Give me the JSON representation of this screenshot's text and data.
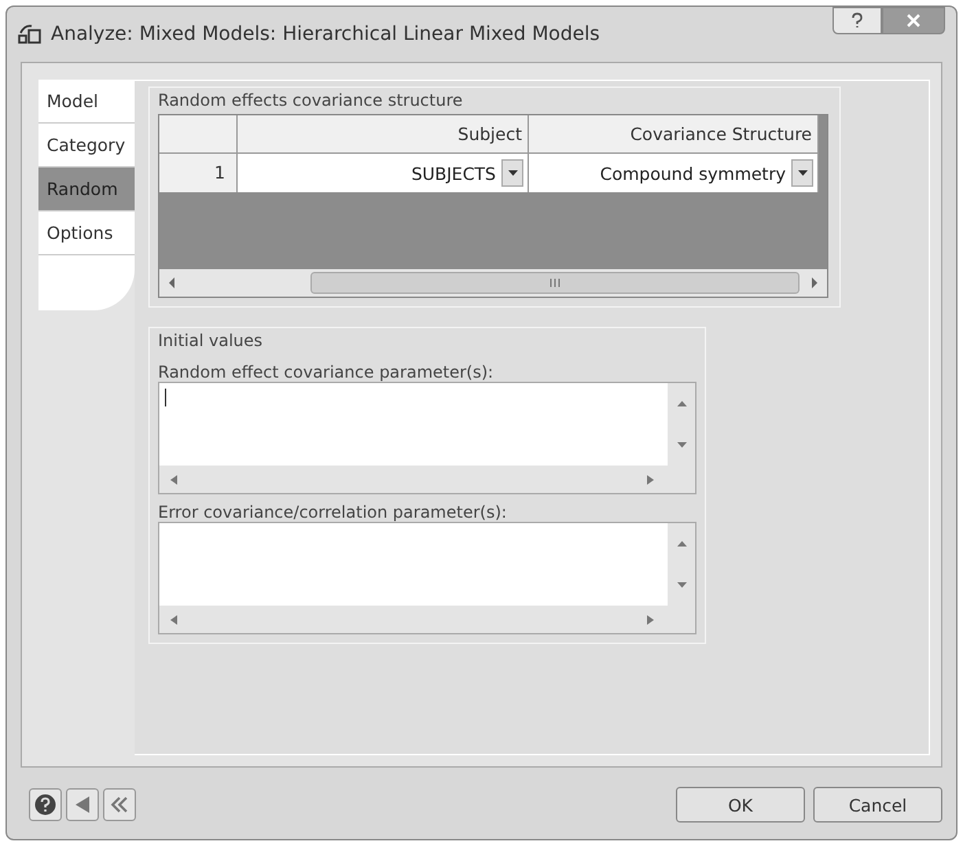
{
  "window": {
    "title": "Analyze: Mixed Models: Hierarchical Linear Mixed Models"
  },
  "tabs": [
    {
      "label": "Model",
      "selected": false
    },
    {
      "label": "Category",
      "selected": false
    },
    {
      "label": "Random",
      "selected": true
    },
    {
      "label": "Options",
      "selected": false
    }
  ],
  "random_effects": {
    "title": "Random effects covariance structure",
    "columns": [
      "Subject",
      "Covariance Structure"
    ],
    "rows": [
      {
        "number": "1",
        "subject": "SUBJECTS",
        "covariance_structure": "Compound symmetry"
      }
    ]
  },
  "initial_values": {
    "title": "Initial values",
    "fields": [
      {
        "label": "Random effect covariance parameter(s):",
        "focused": true
      },
      {
        "label": "Error covariance/correlation parameter(s):",
        "focused": false
      }
    ]
  },
  "buttons": [
    "OK",
    "Cancel"
  ]
}
